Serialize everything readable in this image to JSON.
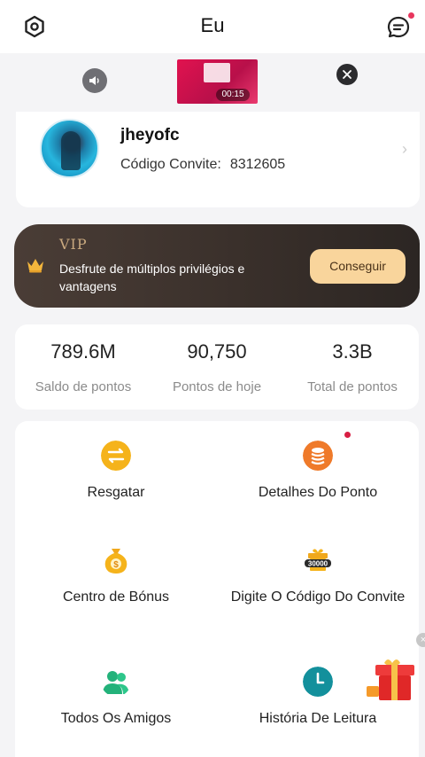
{
  "header": {
    "title": "Eu"
  },
  "ad": {
    "timer": "00:15"
  },
  "profile": {
    "username": "jheyofc",
    "invite_label": "Código Convite:",
    "invite_code": "8312605"
  },
  "vip": {
    "title": "VIP",
    "description": "Desfrute de múltiplos privilégios e vantagens",
    "button": "Conseguir"
  },
  "stats": [
    {
      "value": "789.6M",
      "label": "Saldo de pontos"
    },
    {
      "value": "90,750",
      "label": "Pontos de hoje"
    },
    {
      "value": "3.3B",
      "label": "Total de pontos"
    }
  ],
  "menu": [
    {
      "label": "Resgatar",
      "icon": "exchange-icon"
    },
    {
      "label": "Detalhes Do Ponto",
      "icon": "coins-stack-icon"
    },
    {
      "label": "Centro de Bónus",
      "icon": "money-bag-icon"
    },
    {
      "label": "Digite O Código Do Convite",
      "icon": "gift-box-30000-icon",
      "badge_text": "30000"
    },
    {
      "label": "Todos Os Amigos",
      "icon": "friends-icon"
    },
    {
      "label": "História De Leitura",
      "icon": "clock-icon"
    }
  ],
  "colors": {
    "vip_bg": "#3a302b",
    "vip_button": "#f9d59c",
    "badge": "#d81e43",
    "icon_yellow": "#f5b31b",
    "icon_orange": "#ef7a2a",
    "icon_green": "#23b27a",
    "icon_teal": "#13909c"
  }
}
